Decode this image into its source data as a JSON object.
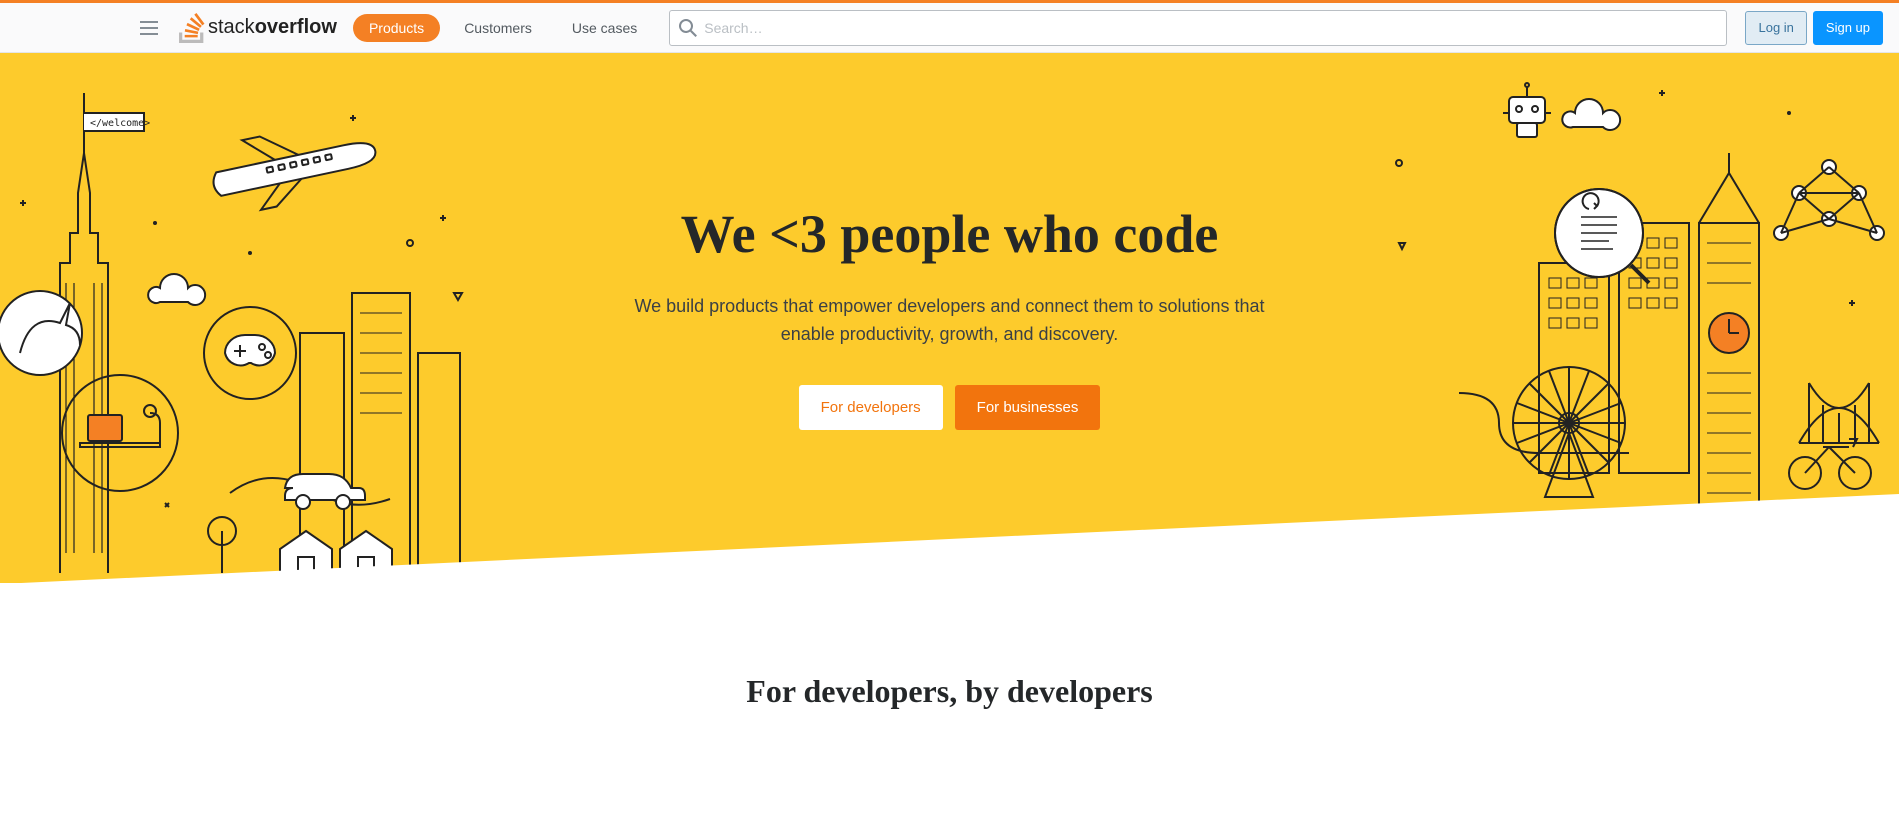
{
  "header": {
    "nav": [
      "Products",
      "Customers",
      "Use cases"
    ],
    "active_index": 0,
    "search_placeholder": "Search…",
    "login": "Log in",
    "signup": "Sign up",
    "logo_text_a": "stack",
    "logo_text_b": "overflow"
  },
  "hero": {
    "title": "We <3 people who code",
    "subtitle": "We build products that empower developers and connect them to solutions that enable productivity, growth, and discovery.",
    "btn_dev": "For developers",
    "btn_biz": "For businesses",
    "flag_text": "</welcome>"
  },
  "section2": {
    "title": "For developers, by developers"
  }
}
